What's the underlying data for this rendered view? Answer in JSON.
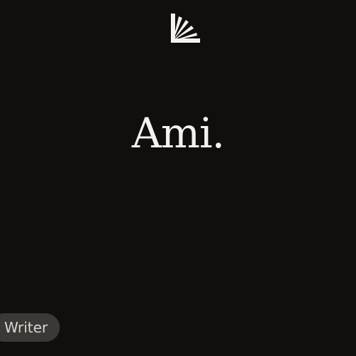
{
  "logo": {
    "icon": "sunburst-logo-icon"
  },
  "main": {
    "title": "Ami."
  },
  "footer": {
    "pill_label": "Writer"
  },
  "colors": {
    "background": "#100f0e",
    "text": "#f4f2ee",
    "pill_background": "#3a3936",
    "pill_text": "#d9d7d2"
  }
}
